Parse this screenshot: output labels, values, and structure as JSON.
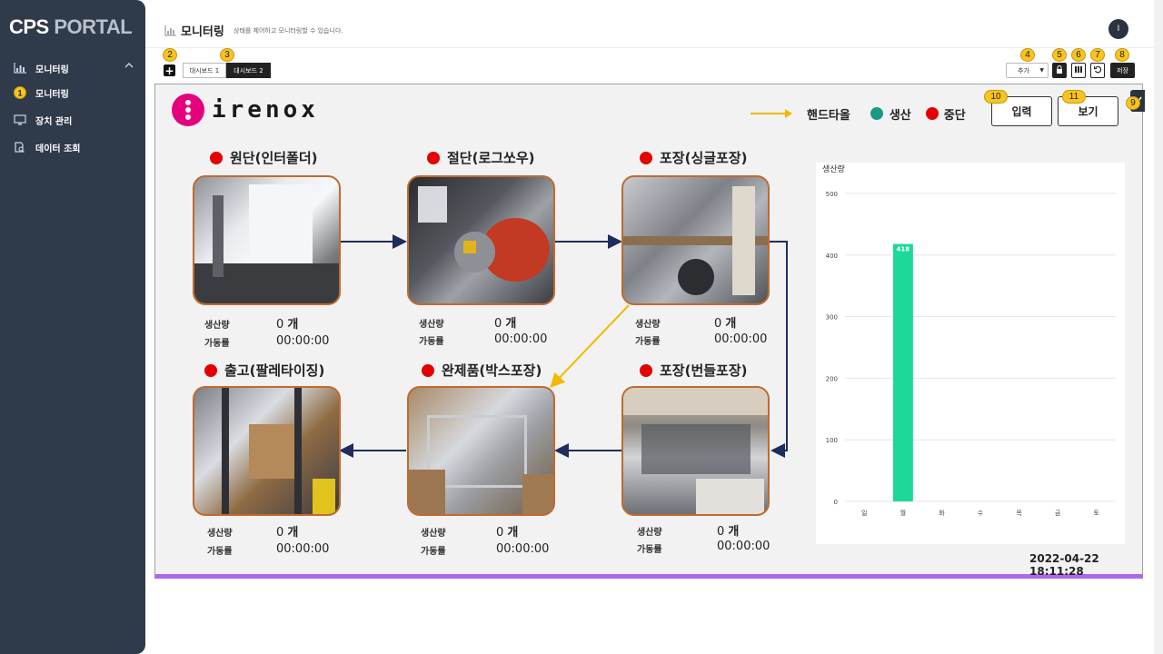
{
  "sidebar": {
    "brand_a": "CPS",
    "brand_b": "PORTAL",
    "group_label": "모니터링",
    "items": [
      {
        "label": "모니터링"
      },
      {
        "label": "장치 관리"
      },
      {
        "label": "데이터 조회"
      }
    ]
  },
  "header": {
    "title": "모니터링",
    "subtitle": "상태를 제어하고 모니터링할 수 있습니다.",
    "avatar": "I"
  },
  "markers": {
    "m1": "1",
    "m2": "2",
    "m3": "3",
    "m4": "4",
    "m5": "5",
    "m6": "6",
    "m7": "7",
    "m8": "8",
    "m9": "9",
    "m10": "10",
    "m11": "11"
  },
  "toolbar": {
    "tabs": [
      "대시보드 1",
      "대시보드 2"
    ],
    "add_select": "추가",
    "save": "저장"
  },
  "panel": {
    "logo_text": "irenox",
    "legend": {
      "handtowel": "핸드타올",
      "produce": "생산",
      "stop": "중단"
    },
    "input_btn": "입력",
    "view_btn": "보기",
    "stat_labels": {
      "prod": "생산량",
      "uptime": "가동률"
    },
    "processes": [
      {
        "name": "원단(인터폴더)",
        "count": "0",
        "unit": "개",
        "time": "00:00:00"
      },
      {
        "name": "절단(로그쏘우)",
        "count": "0",
        "unit": "개",
        "time": "00:00:00"
      },
      {
        "name": "포장(싱글포장)",
        "count": "0",
        "unit": "개",
        "time": "00:00:00"
      },
      {
        "name": "출고(팔레타이징)",
        "count": "0",
        "unit": "개",
        "time": "00:00:00"
      },
      {
        "name": "완제품(박스포장)",
        "count": "0",
        "unit": "개",
        "time": "00:00:00"
      },
      {
        "name": "포장(번들포장)",
        "count": "0",
        "unit": "개",
        "time": "00:00:00"
      }
    ],
    "timestamp": "2022-04-22 18:11:28"
  },
  "colors": {
    "accent_purple": "#b266ea",
    "bar_green": "#1ed89a",
    "status_red": "#e60000",
    "status_green": "#1a9a86",
    "arrow_navy": "#1f2d5c",
    "arrow_yellow": "#f5b800"
  },
  "chart_data": {
    "type": "bar",
    "ylabel": "생산량",
    "categories": [
      "일",
      "월",
      "화",
      "수",
      "목",
      "금",
      "토"
    ],
    "values": [
      0,
      418,
      0,
      0,
      0,
      0,
      0
    ],
    "data_labels": [
      "",
      "418",
      "",
      "",
      "",
      "",
      ""
    ],
    "yticks": [
      0,
      100,
      200,
      300,
      400,
      500
    ],
    "ylim": [
      0,
      500
    ],
    "grid": true
  }
}
